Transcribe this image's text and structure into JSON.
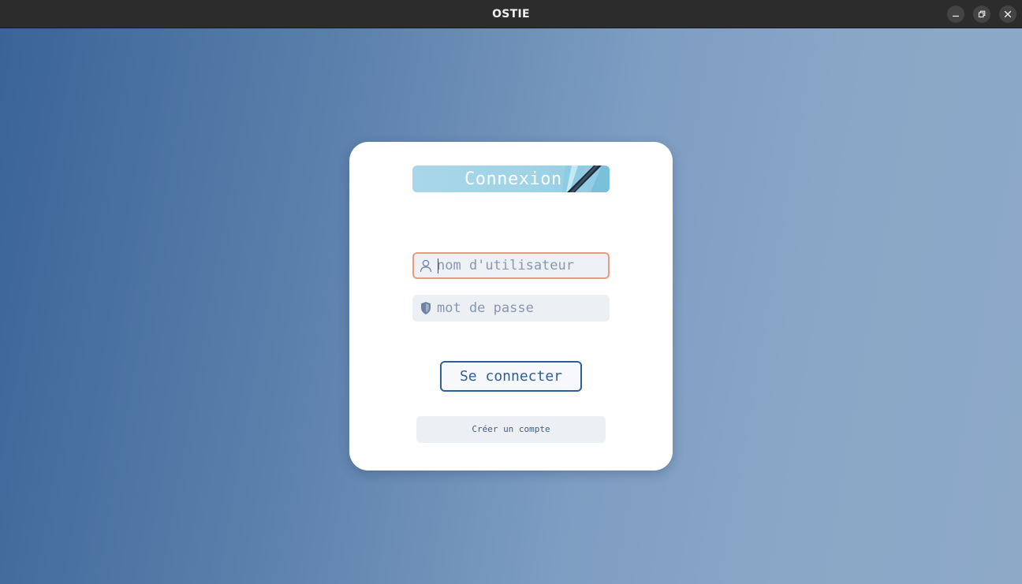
{
  "window": {
    "title": "OSTIE",
    "controls": {
      "minimize": "minimize-icon",
      "maximize": "restore-icon",
      "close": "close-icon"
    }
  },
  "login": {
    "banner_title": "Connexion",
    "username": {
      "value": "",
      "placeholder": "nom d'utilisateur",
      "icon": "user-icon"
    },
    "password": {
      "value": "",
      "placeholder": "mot de passe",
      "icon": "shield-icon"
    },
    "submit_label": "Se connecter",
    "create_account_label": "Créer un compte"
  },
  "colors": {
    "focus_border": "#e99a83",
    "accent": "#2f5e94",
    "banner": "#a8d7e8"
  }
}
